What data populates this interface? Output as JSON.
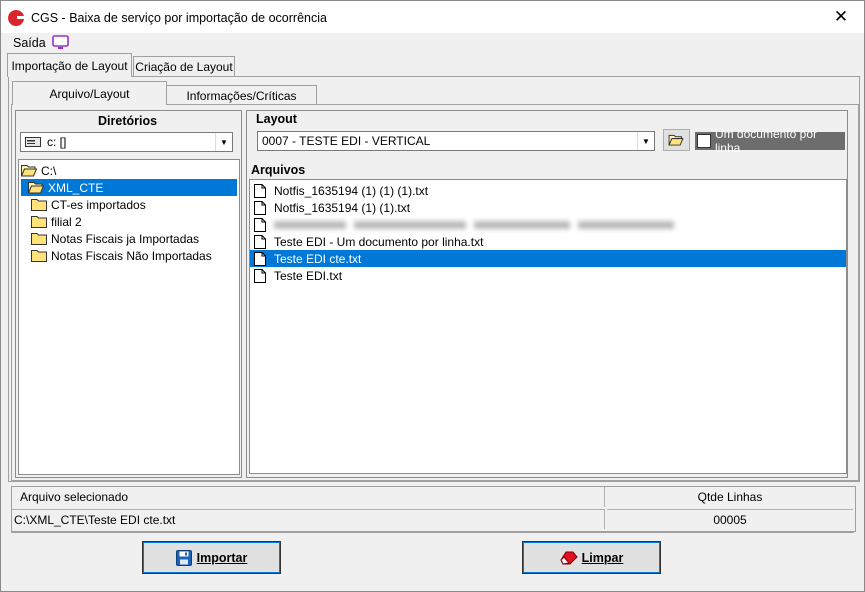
{
  "window": {
    "title": "CGS - Baixa de serviço por importação de ocorrência",
    "app_icon": "cgs-logo-icon",
    "close_icon": "close-icon"
  },
  "menu": {
    "saida_label": "Saída",
    "monitor_icon": "monitor-icon"
  },
  "tabs": [
    {
      "label": "Importação de Layout",
      "active": true
    },
    {
      "label": "Criação de Layout",
      "active": false
    }
  ],
  "inner_tabs": [
    {
      "label": "Arquivo/Layout",
      "active": true
    },
    {
      "label": "Informações/Críticas",
      "active": false
    }
  ],
  "directories": {
    "header": "Diretórios",
    "drive_value": "c: []",
    "tree": [
      {
        "label": "C:\\",
        "level": 0,
        "open": true,
        "selected": false
      },
      {
        "label": "XML_CTE",
        "level": 1,
        "open": true,
        "selected": true
      },
      {
        "label": "CT-es importados",
        "level": 2,
        "open": false,
        "selected": false
      },
      {
        "label": "filial 2",
        "level": 2,
        "open": false,
        "selected": false
      },
      {
        "label": "Notas Fiscais ja Importadas",
        "level": 2,
        "open": false,
        "selected": false
      },
      {
        "label": "Notas Fiscais Não Importadas",
        "level": 2,
        "open": false,
        "selected": false
      }
    ]
  },
  "layout": {
    "header": "Layout",
    "selected_value": "0007 - TESTE EDI - VERTICAL",
    "open_folder_icon": "open-folder-icon",
    "checkbox_label": "Um documento por linha",
    "checkbox_checked": false
  },
  "files": {
    "header": "Arquivos",
    "items": [
      {
        "name": "Notfis_1635194 (1) (1) (1).txt",
        "selected": false,
        "blurred": false
      },
      {
        "name": "Notfis_1635194 (1) (1).txt",
        "selected": false,
        "blurred": false
      },
      {
        "name": "",
        "selected": false,
        "blurred": true
      },
      {
        "name": "Teste EDI - Um documento por linha.txt",
        "selected": false,
        "blurred": false
      },
      {
        "name": "Teste EDI cte.txt",
        "selected": true,
        "blurred": false
      },
      {
        "name": "Teste EDI.txt",
        "selected": false,
        "blurred": false
      }
    ]
  },
  "status": {
    "file_header": "Arquivo selecionado",
    "lines_header": "Qtde Linhas",
    "file_value": "C:\\XML_CTE\\Teste EDI cte.txt",
    "lines_value": "00005"
  },
  "buttons": {
    "import_label": "Importar",
    "import_icon": "save-disk-icon",
    "clear_label": "Limpar",
    "clear_icon": "eraser-icon"
  }
}
